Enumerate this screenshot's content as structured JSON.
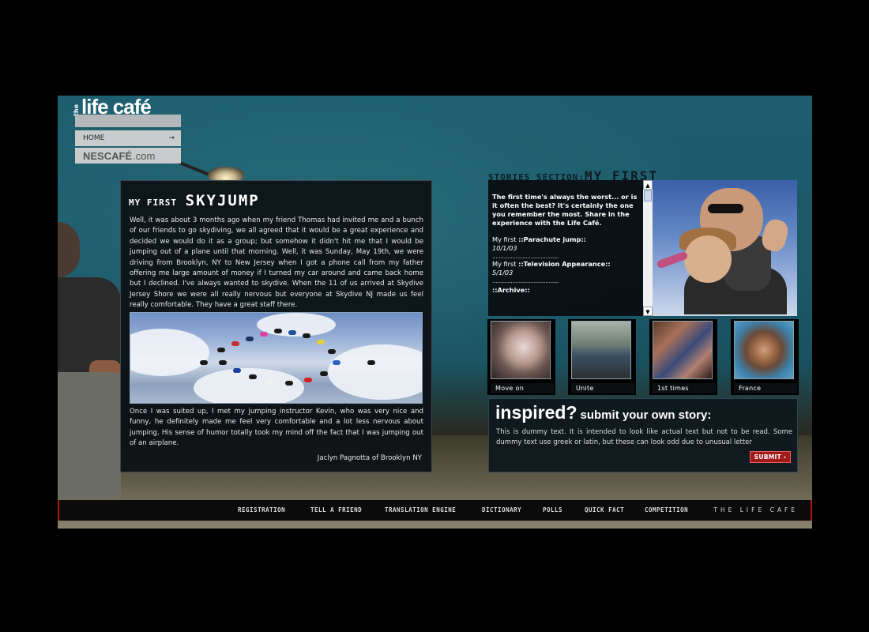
{
  "brand": {
    "logo_the": "the",
    "logo_name": "life café",
    "nescafe": "NESCAFÉ",
    "nescafe_suffix": ".com"
  },
  "nav": {
    "home_label": "HOME",
    "home_arrow": "→"
  },
  "story": {
    "title_small": "MY FIRST",
    "title_big": "SKYJUMP",
    "paragraph1": "Well, it was about 3 months ago when my friend Thomas had invited me and a bunch of our friends to go skydiving, we all agreed that it would be a great experience and decided we would do it as a group; but somehow it didn't hit me that I would be jumping out of a plane until that morning. Well, it was Sunday, May 19th, we were driving from Brooklyn, NY to New Jersey when I got a phone call from my father offering me large amount of money if I turned my car around and came back home but I declined. I've always wanted to skydive. When the 11 of us arrived at Skydive Jersey Shore we were all really nervous but everyone at Skydive NJ made us feel really comfortable. They have a great staff there.",
    "paragraph2": "Once I was suited up, I met my jumping instructor Kevin, who was very nice and funny, he definitely made me feel very comfortable and a lot less nervous about jumping. His sense of humor totally took my mind off the fact that I was jumping out of an airplane.",
    "signature": "Jaclyn Pagnotta of Brooklyn NY"
  },
  "stories_section": {
    "title_small": "STORIES SECTION:",
    "title_big": "MY FIRST",
    "intro": "The first time's always the worst... or is it often the best? It's certainly the one you remember the most. Share in the experience with the Life Café.",
    "entries": [
      {
        "prefix": "My first",
        "title": "::Parachute jump::",
        "date": "10/1/03"
      },
      {
        "prefix": "My first",
        "title": "::Television Appearance::",
        "date": "5/1/03"
      }
    ],
    "dots": "........................................",
    "archive": "::Archive::",
    "scroll_up": "▲",
    "scroll_down": "▼"
  },
  "thumbnails": [
    {
      "label": "Move on"
    },
    {
      "label": "Unite"
    },
    {
      "label": "1st times"
    },
    {
      "label": "France"
    }
  ],
  "inspired": {
    "headline": "inspired?",
    "subhead": "submit your own story:",
    "body": "This is dummy text. It is intended to look like actual text but not to be read. Some dummy text use greek or latin, but these can look odd due to unusual letter",
    "submit_label": "SUBMIT ›"
  },
  "footer": {
    "links": [
      "REGISTRATION",
      "TELL A FRIEND",
      "TRANSLATION ENGINE",
      "DICTIONARY",
      "POLLS",
      "QUICK FACT",
      "COMPETITION"
    ],
    "brand": "THE LIFE CAFE"
  }
}
